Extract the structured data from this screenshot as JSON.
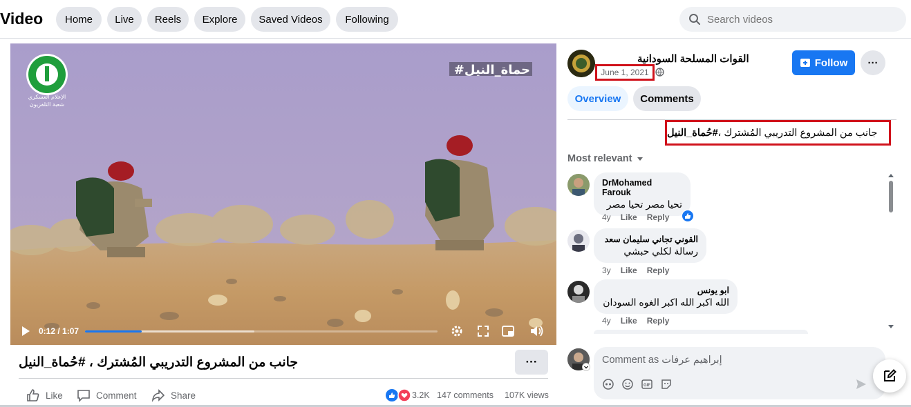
{
  "header": {
    "title": "Video",
    "nav": [
      "Home",
      "Live",
      "Reels",
      "Explore",
      "Saved Videos",
      "Following"
    ],
    "search_placeholder": "Search videos"
  },
  "video": {
    "overlay_hashtag": "#حماة_النيل",
    "logo_caption_line1": "الإعلام العسكري",
    "logo_caption_line2": "شعبة التلفزيون",
    "current_time": "0:12 / 1:07",
    "progress": 0.16,
    "buffered": 0.48,
    "title": "جانب من المشروع التدريبي المُشترك ، #حُماة_النيل"
  },
  "actions": {
    "like": "Like",
    "comment": "Comment",
    "share": "Share",
    "reactions_count": "3.2K",
    "comments_count": "147 comments",
    "views": "107K views"
  },
  "page": {
    "name": "القوات المسلحة السودانية",
    "date": "June 1, 2021",
    "follow_label": "Follow"
  },
  "tabs": {
    "overview": "Overview",
    "comments": "Comments"
  },
  "description": {
    "text": "جانب من المشروع التدريبي المُشترك ، ",
    "hashtag": "#حُماة_النيل"
  },
  "sort_label": "Most relevant",
  "comments": [
    {
      "name": "DrMohamed Farouk",
      "text": "تحيا مصر تحيا مصر",
      "age": "4y",
      "like": "Like",
      "reply": "Reply"
    },
    {
      "name": "القوني تجاني سليمان سعد",
      "text": "رسالة لكلي حبشي",
      "age": "3y",
      "like": "Like",
      "reply": "Reply"
    },
    {
      "name": "ابو يونس",
      "text": "الله اكبر الله اكبر الغوه السودان",
      "age": "4y",
      "like": "Like",
      "reply": "Reply"
    }
  ],
  "composer": {
    "placeholder": "Comment as إبراهيم عرفات"
  },
  "colors": {
    "accent": "#1877f2",
    "highlight_box": "#d0121b"
  }
}
